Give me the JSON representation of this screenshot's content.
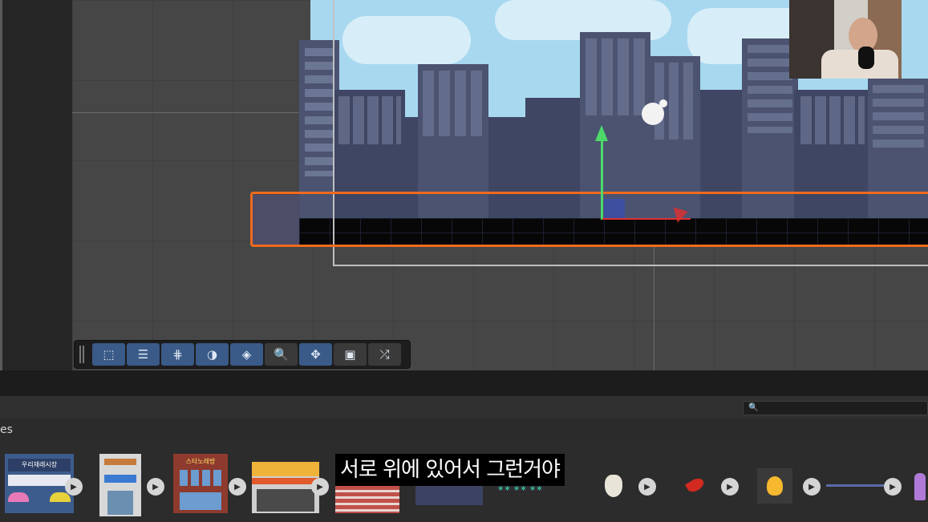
{
  "toolbar": {
    "tools": [
      {
        "name": "rect-tool-icon",
        "glyph": "⬚",
        "active": true
      },
      {
        "name": "align-tool-icon",
        "glyph": "☰",
        "active": true
      },
      {
        "name": "grid-snap-tool-icon",
        "glyph": "⋕",
        "active": true
      },
      {
        "name": "fill-tool-icon",
        "glyph": "◑",
        "active": true
      },
      {
        "name": "tilemap-tool-icon",
        "glyph": "◈",
        "active": true
      },
      {
        "name": "zoom-tool-icon",
        "glyph": "🔍",
        "active": false
      },
      {
        "name": "move-tool-icon",
        "glyph": "✥",
        "active": true
      },
      {
        "name": "camera-tool-icon",
        "glyph": "▣",
        "active": false
      },
      {
        "name": "shuffle-tool-icon",
        "glyph": "⤮",
        "active": false
      }
    ]
  },
  "search": {
    "placeholder": "",
    "icon": "search-icon"
  },
  "panel": {
    "title_fragment": "es"
  },
  "assets": {
    "items": [
      {
        "name": "market-sign-asset",
        "sign_text": "우리재래시장"
      },
      {
        "name": "building-asset"
      },
      {
        "name": "karaoke-building-asset",
        "sign_text": "스타노래방"
      },
      {
        "name": "shop-front-asset"
      },
      {
        "name": "striped-awning-asset"
      },
      {
        "name": "dark-building-asset"
      },
      {
        "name": "grass-tiles-asset"
      },
      {
        "name": "garlic-asset"
      },
      {
        "name": "chili-pepper-asset"
      },
      {
        "name": "fire-asset"
      },
      {
        "name": "line-asset"
      },
      {
        "name": "character-asset"
      }
    ]
  },
  "subtitle": {
    "text": "서로 위에 있어서 그런거야"
  },
  "colors": {
    "selection": "#f06a1e",
    "sky": "#a8d8f0",
    "tool_active": "#3a5a88",
    "gizmo_up": "#4cd96a",
    "gizmo_right": "#e03030"
  }
}
